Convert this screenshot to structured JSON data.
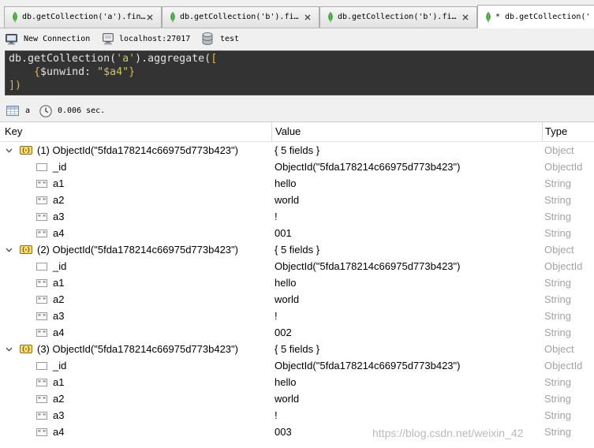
{
  "tabs": [
    {
      "label": "db.getCollection('a').fin…",
      "active": false
    },
    {
      "label": "db.getCollection('b').fi…",
      "active": false
    },
    {
      "label": "db.getCollection('b').fi…",
      "active": false
    },
    {
      "label": "* db.getCollection('",
      "active": true
    }
  ],
  "connection": {
    "name": "New Connection",
    "host": "localhost:27017",
    "database": "test"
  },
  "editor": {
    "lines": [
      {
        "tokens": [
          {
            "text": "db.getCollection(",
            "color": "#e4e4e4"
          },
          {
            "text": "'a'",
            "color": "#c9c36a"
          },
          {
            "text": ").aggregate(",
            "color": "#e4e4e4"
          },
          {
            "text": "[",
            "color": "#e3b54a"
          }
        ]
      },
      {
        "tokens": [
          {
            "text": "    ",
            "color": "#e4e4e4"
          },
          {
            "text": "{",
            "color": "#e3b54a"
          },
          {
            "text": "$unwind: ",
            "color": "#e4e4e4"
          },
          {
            "text": "\"$a4\"",
            "color": "#c9c36a"
          },
          {
            "text": "}",
            "color": "#e3b54a"
          }
        ]
      },
      {
        "tokens": [
          {
            "text": "])",
            "color": "#e3b54a"
          }
        ]
      }
    ]
  },
  "results": {
    "collection": "a",
    "elapsed": "0.006 sec."
  },
  "columns": {
    "key": "Key",
    "value": "Value",
    "type": "Type"
  },
  "documents": [
    {
      "key": "(1) ObjectId(\"5fda178214c66975d773b423\")",
      "value": "{ 5 fields }",
      "type": "Object",
      "icon": "object-icon",
      "fields": [
        {
          "key": "_id",
          "value": "ObjectId(\"5fda178214c66975d773b423\")",
          "type": "ObjectId",
          "icon": "objectid-icon"
        },
        {
          "key": "a1",
          "value": "hello",
          "type": "String",
          "icon": "string-icon"
        },
        {
          "key": "a2",
          "value": "world",
          "type": "String",
          "icon": "string-icon"
        },
        {
          "key": "a3",
          "value": "!",
          "type": "String",
          "icon": "string-icon"
        },
        {
          "key": "a4",
          "value": "001",
          "type": "String",
          "icon": "string-icon"
        }
      ]
    },
    {
      "key": "(2) ObjectId(\"5fda178214c66975d773b423\")",
      "value": "{ 5 fields }",
      "type": "Object",
      "icon": "object-icon",
      "fields": [
        {
          "key": "_id",
          "value": "ObjectId(\"5fda178214c66975d773b423\")",
          "type": "ObjectId",
          "icon": "objectid-icon"
        },
        {
          "key": "a1",
          "value": "hello",
          "type": "String",
          "icon": "string-icon"
        },
        {
          "key": "a2",
          "value": "world",
          "type": "String",
          "icon": "string-icon"
        },
        {
          "key": "a3",
          "value": "!",
          "type": "String",
          "icon": "string-icon"
        },
        {
          "key": "a4",
          "value": "002",
          "type": "String",
          "icon": "string-icon"
        }
      ]
    },
    {
      "key": "(3) ObjectId(\"5fda178214c66975d773b423\")",
      "value": "{ 5 fields }",
      "type": "Object",
      "icon": "object-icon",
      "fields": [
        {
          "key": "_id",
          "value": "ObjectId(\"5fda178214c66975d773b423\")",
          "type": "ObjectId",
          "icon": "objectid-icon"
        },
        {
          "key": "a1",
          "value": "hello",
          "type": "String",
          "icon": "string-icon"
        },
        {
          "key": "a2",
          "value": "world",
          "type": "String",
          "icon": "string-icon"
        },
        {
          "key": "a3",
          "value": "!",
          "type": "String",
          "icon": "string-icon"
        },
        {
          "key": "a4",
          "value": "003",
          "type": "String",
          "icon": "string-icon"
        }
      ]
    }
  ],
  "icons": {
    "tab": "mongodb-leaf-icon",
    "tab_close": "close-icon",
    "connection": "computer-icon",
    "server": "server-icon",
    "database": "database-icon",
    "collection": "table-icon",
    "elapsed": "clock-icon",
    "expand": "chevron-down-icon"
  },
  "colors": {
    "editor_background": "#333333",
    "type_text": "#a3a3a3",
    "leaf": "#3f9c35",
    "active_tab": "#ffffff"
  },
  "watermark": "https://blog.csdn.net/weixin_42"
}
